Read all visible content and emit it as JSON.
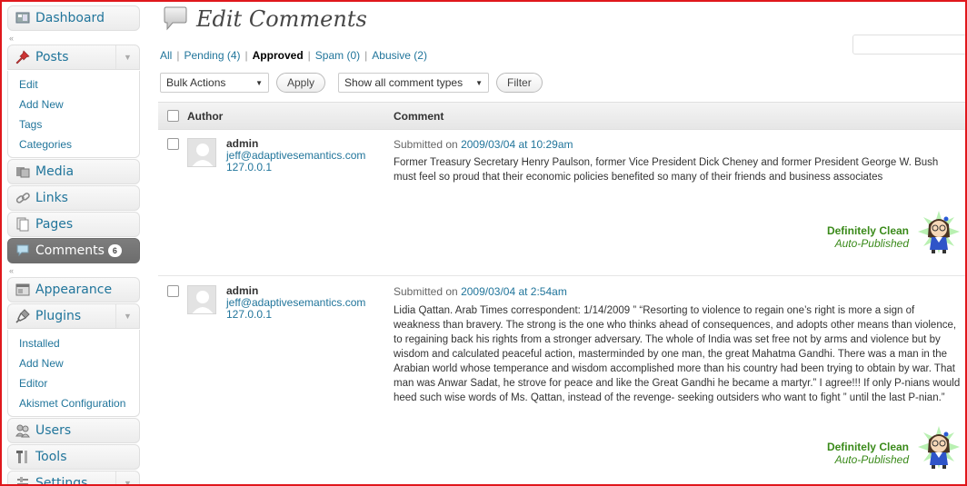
{
  "sidebar": {
    "dashboard": "Dashboard",
    "posts": {
      "label": "Posts",
      "items": [
        "Edit",
        "Add New",
        "Tags",
        "Categories"
      ]
    },
    "media": "Media",
    "links": "Links",
    "pages": "Pages",
    "comments": {
      "label": "Comments",
      "count": "6"
    },
    "appearance": "Appearance",
    "plugins": {
      "label": "Plugins",
      "items": [
        "Installed",
        "Add New",
        "Editor",
        "Akismet Configuration"
      ]
    },
    "users": "Users",
    "tools": "Tools",
    "settings": "Settings"
  },
  "header": {
    "title": "Edit Comments"
  },
  "filters": {
    "all": "All",
    "pending": "Pending (4)",
    "approved": "Approved",
    "spam": "Spam (0)",
    "abusive": "Abusive (2)"
  },
  "toolbar": {
    "bulk_actions": "Bulk Actions",
    "apply": "Apply",
    "comment_types": "Show all comment types",
    "filter": "Filter"
  },
  "table": {
    "columns": {
      "author": "Author",
      "comment": "Comment"
    },
    "submitted_prefix": "Submitted on",
    "rows": [
      {
        "author": "admin",
        "email": "jeff@adaptivesemantics.com",
        "ip": "127.0.0.1",
        "date": "2009/03/04 at 10:29am",
        "text": "Former Treasury Secretary Henry Paulson, former Vice President Dick Cheney and former President George W. Bush must feel so proud that their economic policies benefited so many of their friends and business associates",
        "status": "Definitely Clean",
        "substatus": "Auto-Published"
      },
      {
        "author": "admin",
        "email": "jeff@adaptivesemantics.com",
        "ip": "127.0.0.1",
        "date": "2009/03/04 at 2:54am",
        "text": "Lidia Qattan. Arab Times correspondent: 1/14/2009 ” “Resorting to violence to regain one’s right is more a sign of weakness than bravery. The strong is the one who thinks ahead of consequences, and adopts other means than violence, to regaining back his rights from a stronger adversary. The whole of India was set free not by arms and violence but by wisdom and calculated peaceful action, masterminded by one man, the great Mahatma Gandhi. There was a man in the Arabian world whose temperance and wisdom accomplished more than his country had been trying to obtain by war. That man was Anwar Sadat, he strove for peace and like the Great Gandhi he became a martyr.” I agree!!! If only P-nians would heed such wise words of Ms. Qattan, instead of the revenge- seeking outsiders who want to fight ” until the last P-nian.”",
        "status": "Definitely Clean",
        "substatus": "Auto-Published"
      }
    ]
  }
}
